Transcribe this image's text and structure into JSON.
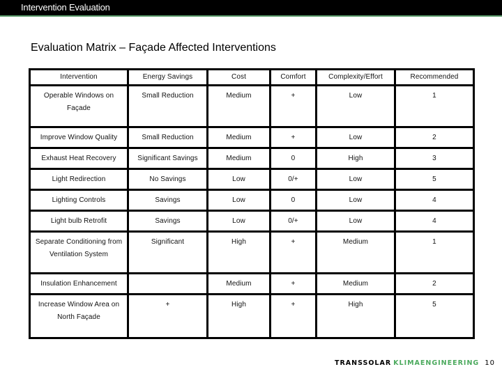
{
  "header": {
    "title": "Intervention Evaluation",
    "accent_color": "#5a9a6a"
  },
  "page_title": "Evaluation Matrix – Façade Affected Interventions",
  "table": {
    "columns": [
      "Intervention",
      "Energy Savings",
      "Cost",
      "Comfort",
      "Complexity/Effort",
      "Recommended"
    ],
    "rows": [
      {
        "intervention": "Operable Windows on Façade",
        "energy_savings": "Small Reduction",
        "cost": "Medium",
        "comfort": "+",
        "complexity": "Low",
        "recommended": "1"
      },
      {
        "intervention": "Improve Window Quality",
        "energy_savings": "Small Reduction",
        "cost": "Medium",
        "comfort": "+",
        "complexity": "Low",
        "recommended": "2"
      },
      {
        "intervention": "Exhaust Heat Recovery",
        "energy_savings": "Significant Savings",
        "cost": "Medium",
        "comfort": "0",
        "complexity": "High",
        "recommended": "3"
      },
      {
        "intervention": "Light Redirection",
        "energy_savings": "No Savings",
        "cost": "Low",
        "comfort": "0/+",
        "complexity": "Low",
        "recommended": "5"
      },
      {
        "intervention": "Lighting Controls",
        "energy_savings": "Savings",
        "cost": "Low",
        "comfort": "0",
        "complexity": "Low",
        "recommended": "4"
      },
      {
        "intervention": "Light bulb Retrofit",
        "energy_savings": "Savings",
        "cost": "Low",
        "comfort": "0/+",
        "complexity": "Low",
        "recommended": "4"
      },
      {
        "intervention": "Separate Conditioning from Ventilation System",
        "energy_savings": "Significant",
        "cost": "High",
        "comfort": "+",
        "complexity": "Medium",
        "recommended": "1"
      },
      {
        "intervention": "Insulation Enhancement",
        "energy_savings": "",
        "cost": "Medium",
        "comfort": "+",
        "complexity": "Medium",
        "recommended": "2"
      },
      {
        "intervention": "Increase Window Area on North Façade",
        "energy_savings": "+",
        "cost": "High",
        "comfort": "+",
        "complexity": "High",
        "recommended": "5"
      }
    ]
  },
  "footer": {
    "brand_primary": "TRANSSOLAR",
    "brand_secondary": "KLIMAENGINEERING",
    "brand_secondary_color": "#4caa5e",
    "page_number": "10"
  }
}
